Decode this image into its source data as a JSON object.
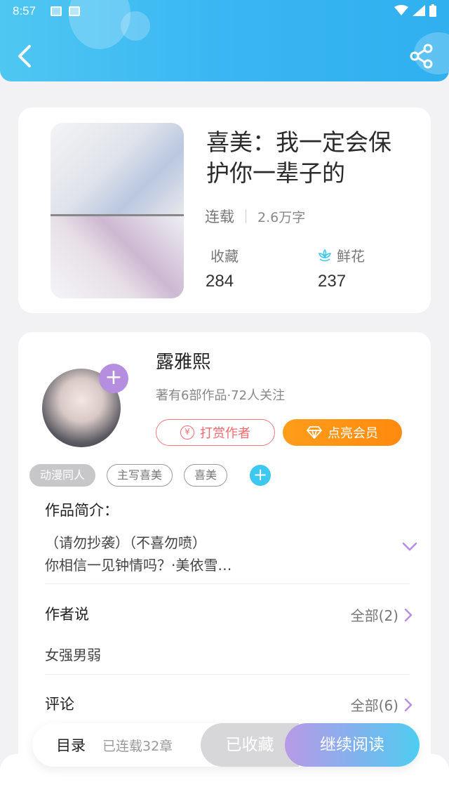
{
  "status_bar": {
    "time": "8:57"
  },
  "header": {
    "back_icon": "back-arrow-icon",
    "share_icon": "share-icon"
  },
  "book": {
    "title": "喜美：我一定会保护你一辈子的",
    "status": "连载",
    "word_count": "2.6万字",
    "favorites_label": "收藏",
    "favorites_value": "284",
    "flowers_label": "鲜花",
    "flowers_value": "237"
  },
  "author": {
    "name": "露雅熙",
    "summary": "著有6部作品·72人关注",
    "reward_label": "打赏作者",
    "vip_label": "点亮会员",
    "tags": [
      "动漫同人",
      "主写喜美",
      "喜美"
    ]
  },
  "intro": {
    "label": "作品简介：",
    "line1": "（请勿抄袭）（不喜勿喷）",
    "line2": "你相信一见钟情吗？·美依雪…"
  },
  "author_says": {
    "label": "作者说",
    "more": "全部(2)",
    "text": "女强男弱"
  },
  "comments": {
    "label": "评论",
    "more": "全部(6)"
  },
  "bottom_bar": {
    "toc_label": "目录",
    "toc_count": "已连载32章",
    "collected_label": "已收藏",
    "read_label": "继续阅读"
  },
  "colors": {
    "header": "#39b6f3",
    "accent_purple": "#b58ee0",
    "reward": "#f06a70",
    "vip": "#ff9114",
    "tag_add": "#3ec8ef"
  }
}
